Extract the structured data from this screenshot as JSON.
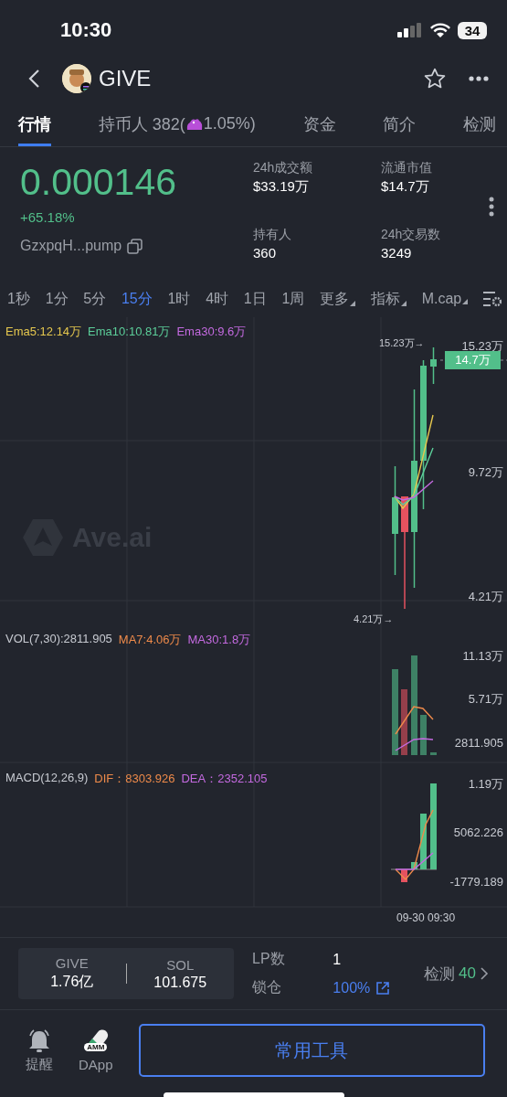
{
  "status_bar": {
    "time": "10:30",
    "battery": "34"
  },
  "header": {
    "title": "GIVE"
  },
  "tabs": [
    {
      "label": "行情",
      "selected": true
    },
    {
      "label": "持币人 382(",
      "badge": "1.05%)",
      "selected": false
    },
    {
      "label": "资金",
      "selected": false
    },
    {
      "label": "简介",
      "selected": false
    },
    {
      "label": "检测",
      "selected": false
    }
  ],
  "price": {
    "value": "0.000146",
    "change": "+65.18%",
    "address": "GzxpqH...pump"
  },
  "stats": [
    {
      "label": "24h成交额",
      "value": "$33.19万"
    },
    {
      "label": "流通市值",
      "value": "$14.7万"
    },
    {
      "label": "持有人",
      "value": "360"
    },
    {
      "label": "24h交易数",
      "value": "3249"
    }
  ],
  "timeframes": [
    {
      "label": "1秒",
      "kind": "plain",
      "selected": false
    },
    {
      "label": "1分",
      "kind": "plain",
      "selected": false
    },
    {
      "label": "5分",
      "kind": "plain",
      "selected": false
    },
    {
      "label": "15分",
      "kind": "plain",
      "selected": true
    },
    {
      "label": "1时",
      "kind": "plain",
      "selected": false
    },
    {
      "label": "4时",
      "kind": "plain",
      "selected": false
    },
    {
      "label": "1日",
      "kind": "plain",
      "selected": false
    },
    {
      "label": "1周",
      "kind": "plain",
      "selected": false
    },
    {
      "label": "更多",
      "kind": "dropdown",
      "selected": false
    },
    {
      "label": "指标",
      "kind": "dropdown",
      "selected": false
    },
    {
      "label": "M.cap",
      "kind": "dropdown",
      "selected": false
    }
  ],
  "chart": {
    "watermark": "Ave.ai",
    "legend": [
      {
        "text": "Ema5:12.14万",
        "color": "#e6c84e"
      },
      {
        "text": "Ema10:10.81万",
        "color": "#5ccf9a"
      },
      {
        "text": "Ema30:9.6万",
        "color": "#c46ae0"
      }
    ],
    "axis": [
      "15.23万",
      "9.72万",
      "4.21万"
    ],
    "high_marker": "15.23万→",
    "low_marker": "4.21万→",
    "current": "14.7万"
  },
  "volume": {
    "legend": [
      {
        "text": "VOL(7,30):2811.905",
        "color": "#c8cbd2"
      },
      {
        "text": "MA7:4.06万",
        "color": "#ee8a4a"
      },
      {
        "text": "MA30:1.8万",
        "color": "#c46ae0"
      }
    ],
    "axis": [
      "11.13万",
      "5.71万",
      "2811.905"
    ]
  },
  "macd": {
    "legend": [
      {
        "text": "MACD(12,26,9)",
        "color": "#c8cbd2"
      },
      {
        "text": "DIF：8303.926",
        "color": "#ee8a4a"
      },
      {
        "text": "DEA：2352.105",
        "color": "#c46ae0"
      }
    ],
    "axis": [
      "1.19万",
      "5062.226",
      "-1779.189"
    ]
  },
  "time_label": "09-30 09:30",
  "pair": [
    {
      "symbol": "GIVE",
      "amount": "1.76亿"
    },
    {
      "symbol": "SOL",
      "amount": "101.675"
    }
  ],
  "lp": {
    "count_label": "LP数",
    "count": "1",
    "lock_label": "锁仓",
    "lock": "100%"
  },
  "check": {
    "label": "检测",
    "score": "40"
  },
  "bottom_nav": [
    {
      "label": "提醒",
      "kind": "bell"
    },
    {
      "label": "DApp",
      "kind": "amm",
      "icon_text": "AMM"
    }
  ],
  "tools_button": "常用工具"
}
